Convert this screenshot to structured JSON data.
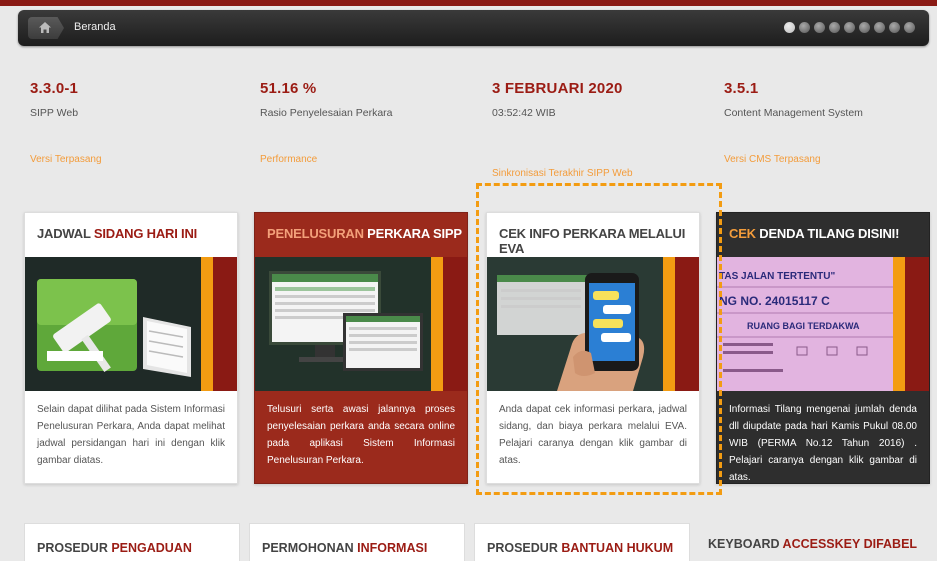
{
  "breadcrumb": {
    "label": "Beranda",
    "slider_dots": 9,
    "active_dot": 0
  },
  "stats": [
    {
      "value": "3.3.0-1",
      "label": "SIPP Web",
      "link": "Versi Terpasang"
    },
    {
      "value": "51.16 %",
      "label": "Rasio Penyelesaian Perkara",
      "link": "Performance"
    },
    {
      "value": "3 FEBRUARI 2020",
      "label": "03:52:42 WIB",
      "link": "Sinkronisasi Terakhir SIPP Web"
    },
    {
      "value": "3.5.1",
      "label": "Content Management System",
      "link": "Versi CMS Terpasang"
    }
  ],
  "cards": [
    {
      "title_a": "JADWAL ",
      "title_b": "SIDANG HARI INI",
      "image": "gavel-book-image",
      "text": "Selain dapat dilihat pada Sistem Informasi Penelusuran Perkara, Anda dapat melihat jadwal persidangan hari ini dengan klik gambar diatas."
    },
    {
      "title_a": "PENELUSURAN ",
      "title_b": "PERKARA SIPP",
      "image": "computer-screens-image",
      "text": "Telusuri serta awasi jalannya proses penyelesaian perkara anda secara online pada aplikasi Sistem Informasi Penelusuran Perkara."
    },
    {
      "title_a": "CEK INFO PERKARA MELALUI EVA",
      "title_b": "",
      "image": "hand-smartphone-image",
      "text": "Anda dapat cek informasi perkara, jadwal sidang, dan biaya perkara melalui EVA. Pelajari caranya dengan klik gambar di atas."
    },
    {
      "title_a": "CEK ",
      "title_b": "DENDA TILANG DISINI!",
      "image": "traffic-ticket-image",
      "ticket_lines": [
        "TAS JALAN TERTENTU\"",
        "NG NO. 24015117 C",
        "RUANG BAGI TERDAKWA"
      ],
      "text": "Informasi Tilang mengenai jumlah denda dll diupdate pada hari Kamis Pukul 08.00 WIB (PERMA No.12 Tahun 2016) . Pelajari caranya dengan klik gambar di atas."
    }
  ],
  "bottom_cards": [
    {
      "a": "PROSEDUR ",
      "b": "PENGADUAN"
    },
    {
      "a": "PERMOHONAN ",
      "b": "INFORMASI"
    },
    {
      "a": "PROSEDUR ",
      "b": "BANTUAN HUKUM"
    },
    {
      "a": "KEYBOARD ",
      "b": "ACCESSKEY DIFABEL"
    }
  ],
  "colors": {
    "brand_red": "#9b1c14",
    "accent_orange": "#f39c12",
    "highlight": "#f39c12"
  }
}
